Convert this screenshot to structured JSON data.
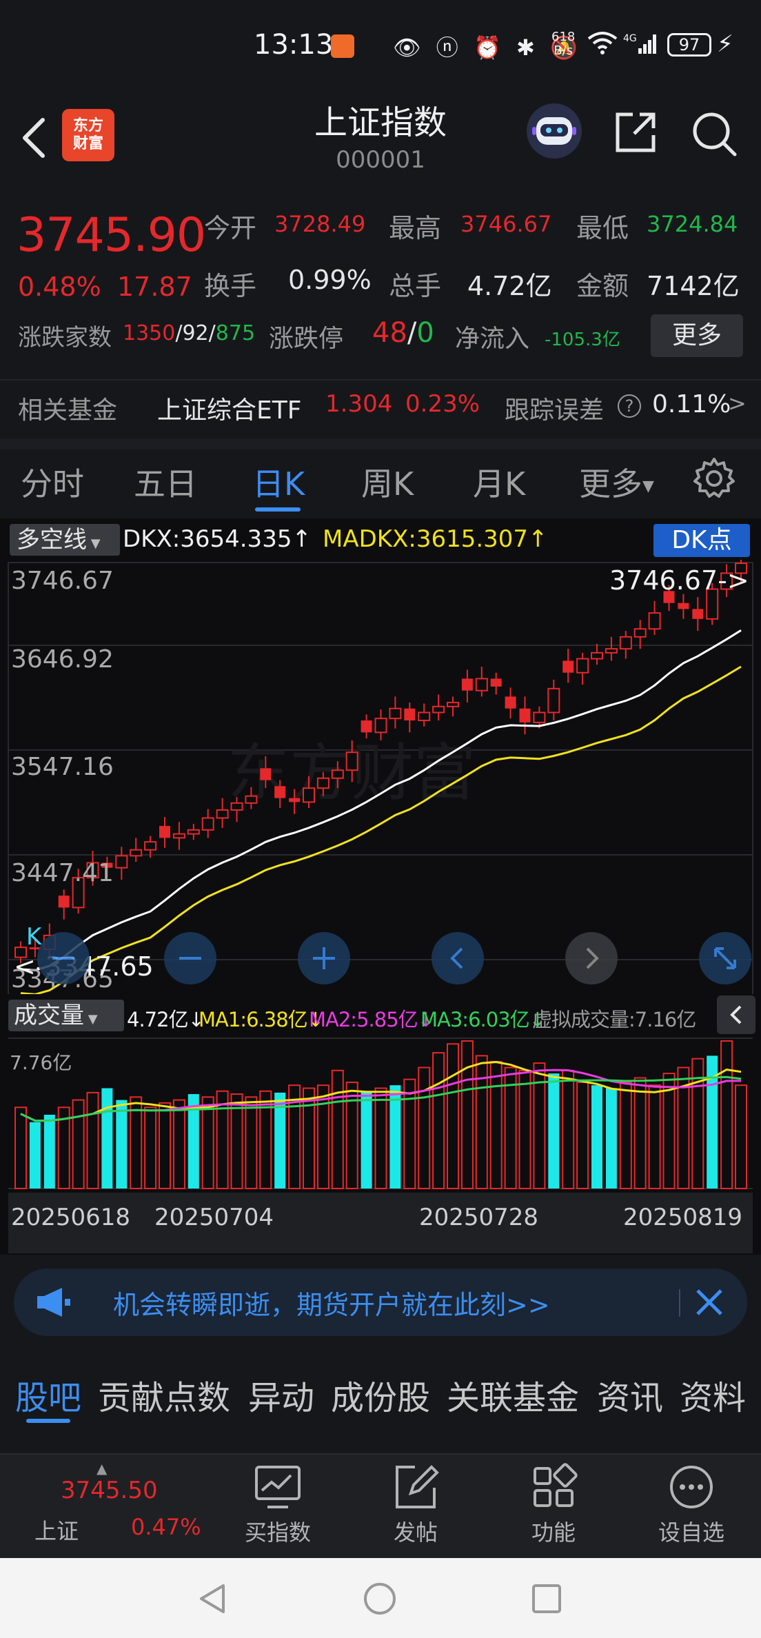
{
  "status_bar": {
    "time": "13:13",
    "net_speed_top": "618",
    "net_speed_bottom": "B/s",
    "battery": "97",
    "signal": "4G"
  },
  "header": {
    "title": "上证指数",
    "code": "000001",
    "logo_line1": "东方",
    "logo_line2": "财富"
  },
  "quote": {
    "price": "3745.90",
    "change_pct": "0.48%",
    "change_val": "17.87",
    "open_label": "今开",
    "open": "3728.49",
    "high_label": "最高",
    "high": "3746.67",
    "low_label": "最低",
    "low": "3724.84",
    "turnover_label": "换手",
    "turnover": "0.99%",
    "volume_label": "总手",
    "volume": "4.72亿",
    "amount_label": "金额",
    "amount": "7142亿",
    "breadth_label": "涨跌家数",
    "breadth_up": "1350",
    "breadth_flat": "92",
    "breadth_down": "875",
    "limit_label": "涨跌停",
    "limit_up": "48",
    "limit_down": "0",
    "netflow_label": "净流入",
    "netflow": "-105.3亿",
    "more_label": "更多"
  },
  "fund": {
    "label": "相关基金",
    "name": "上证综合ETF",
    "price": "1.304",
    "pct": "0.23%",
    "track_label": "跟踪误差",
    "track_help": "?",
    "track_val": "0.11%",
    "arrow": ">"
  },
  "tabs": [
    "分时",
    "五日",
    "日K",
    "周K",
    "月K",
    "更多"
  ],
  "active_tab": "日K",
  "indicator": {
    "select": "多空线",
    "dkx": "DKX:3654.335",
    "dkx_arrow": "↑",
    "madkx": "MADKX:3615.307",
    "madkx_arrow": "↑",
    "dk_button": "DK点"
  },
  "kline": {
    "axis_labels": [
      "3746.67",
      "3646.92",
      "3547.16",
      "3447.41",
      "3347.65"
    ],
    "high_marker": "3746.67->",
    "low_marker": "<-3347.65",
    "k_label": "K"
  },
  "volume": {
    "select": "成交量",
    "total": "4.72亿↓",
    "ma1": "MA1:6.38亿↓",
    "ma2": "MA2:5.85亿↓",
    "ma3": "MA3:6.03亿↓",
    "virtual": "虚拟成交量:7.16亿",
    "axis_max": "7.76亿"
  },
  "dates": [
    "20250618",
    "20250704",
    "20250728",
    "20250819"
  ],
  "ad": {
    "text": "机会转瞬即逝，期货开户就在此刻>>"
  },
  "bottom_tabs": [
    "股吧",
    "贡献点数",
    "异动",
    "成份股",
    "关联基金",
    "资讯",
    "资料"
  ],
  "active_bottom_tab": "股吧",
  "bottom_nav": {
    "index_price": "3745.50",
    "index_label": "上证",
    "index_pct": "0.47%",
    "items": [
      "买指数",
      "发帖",
      "功能",
      "设自选"
    ]
  },
  "colors": {
    "up": "#e5282b",
    "down": "#1fb84b",
    "accent": "#3c8ef0",
    "dkx_line": "#ffffff",
    "madkx_line": "#f2e21a",
    "volume_down": "#1de8e8"
  }
}
